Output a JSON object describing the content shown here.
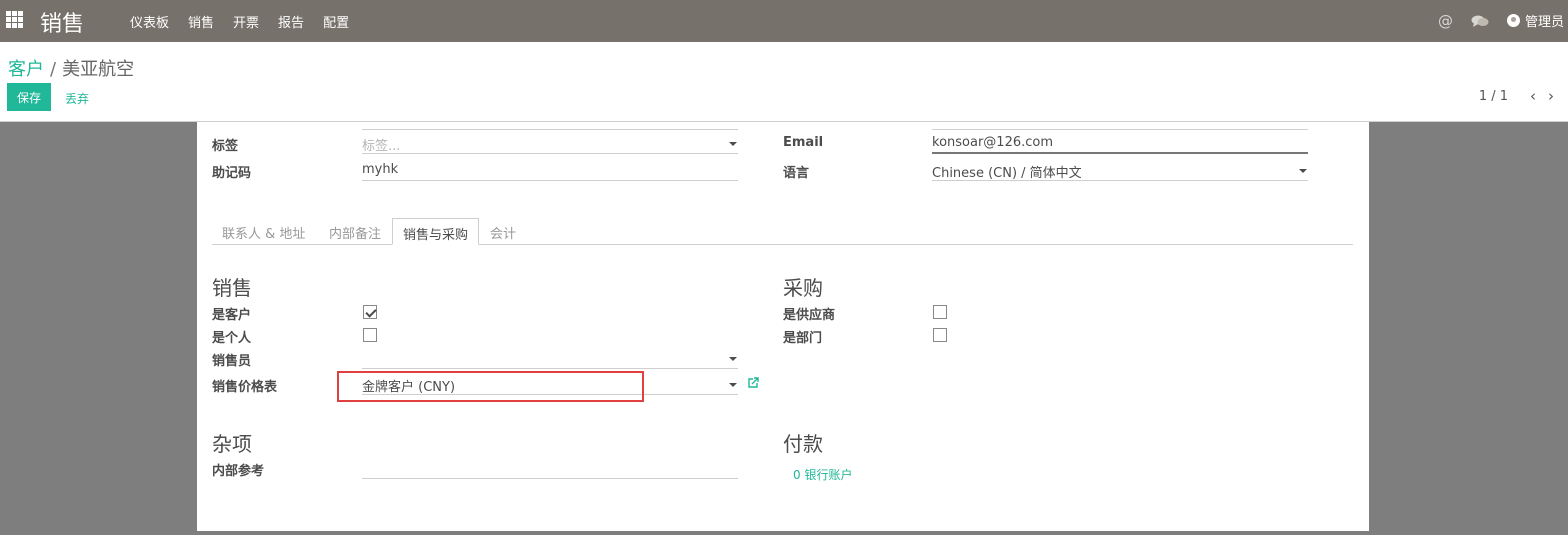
{
  "navbar": {
    "app_name": "销售",
    "menu": [
      "仪表板",
      "销售",
      "开票",
      "报告",
      "配置"
    ],
    "user": "管理员",
    "icons": [
      "apps-grid-icon",
      "at-icon",
      "chat-icon",
      "avatar"
    ]
  },
  "control": {
    "breadcrumb_parent": "客户",
    "breadcrumb_sep": "/",
    "breadcrumb_current": "美亚航空",
    "save_label": "保存",
    "discard_label": "丢弃",
    "pager_value": "1 / 1",
    "pager_prev": "‹",
    "pager_next": "›"
  },
  "form": {
    "tags_label": "标签",
    "tags_placeholder": "标签...",
    "mnemonic_label": "助记码",
    "mnemonic_value": "myhk",
    "email_label": "Email",
    "email_value": "konsoar@126.com",
    "language_label": "语言",
    "language_value": "Chinese (CN) / 简体中文",
    "tabs": [
      "联系人 & 地址",
      "内部备注",
      "销售与采购",
      "会计"
    ],
    "active_tab": "销售与采购",
    "sales_section": "销售",
    "is_customer_label": "是客户",
    "is_customer": true,
    "is_person_label": "是个人",
    "is_person": false,
    "salesperson_label": "销售员",
    "salesperson_value": "",
    "pricelist_label": "销售价格表",
    "pricelist_value": "金牌客户 (CNY)",
    "purchase_section": "采购",
    "is_vendor_label": "是供应商",
    "is_vendor": false,
    "is_department_label": "是部门",
    "is_department": false,
    "misc_section": "杂项",
    "internal_ref_label": "内部参考",
    "internal_ref_value": "",
    "payment_section": "付款",
    "bank_accounts": "0 银行账户"
  },
  "colors": {
    "brand": "#21b799",
    "navbar": "#77716b",
    "highlight": "#e04040"
  }
}
